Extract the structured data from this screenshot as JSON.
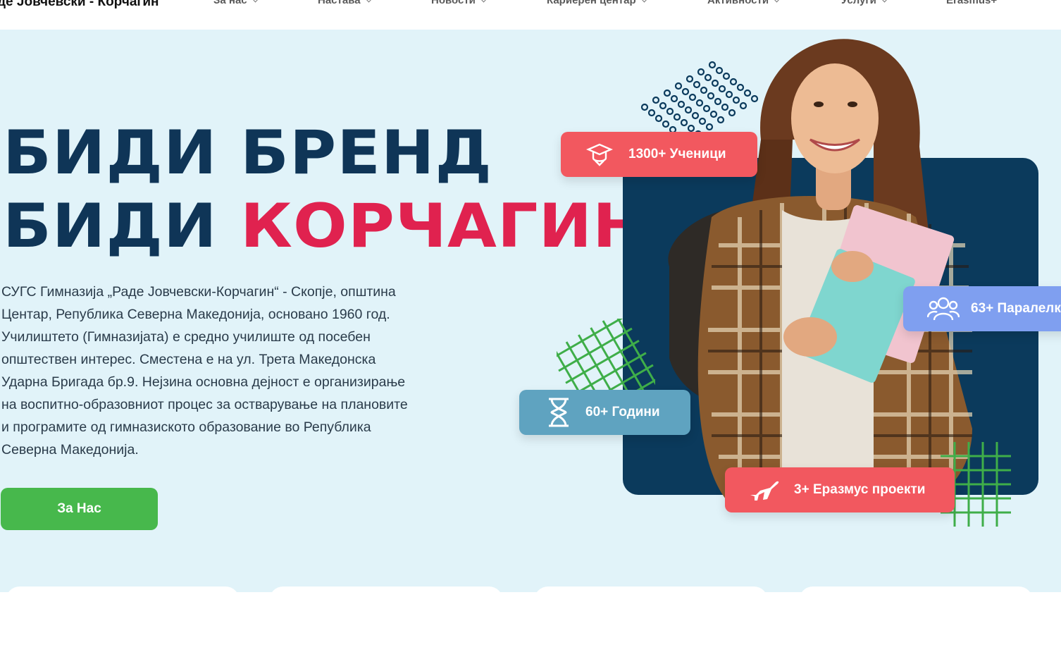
{
  "nav": {
    "brand": "де Јовчевски - Корчагин",
    "items": [
      {
        "label": "За нас"
      },
      {
        "label": "Настава"
      },
      {
        "label": "Новости"
      },
      {
        "label": "Кариерен центар"
      },
      {
        "label": "Активности"
      },
      {
        "label": "Услуги"
      },
      {
        "label": "Erasmus+"
      }
    ]
  },
  "hero": {
    "headline_line1": "БИДИ БРЕНД",
    "headline_line2_prefix": "БИДИ ",
    "headline_line2_accent": "КОРЧАГИН",
    "description": "СУГС Гимназија „Раде Јовчевски-Корчагин“ - Скопје, општина Центар, Република Северна Македонија, основано 1960 год. Училиштето (Гимназијата) е средно училиште од посебен општествен интерес. Сместена е на ул. Трета Македонска Ударна Бригада бр.9. Нејзина основна дејност е организирање на воспитно-образовниот процес за остварување на плановите и програмите од гимназиското образование во Република Северна Македонија.",
    "cta_label": "За Нас"
  },
  "stats": [
    {
      "label": "1300+ Ученици",
      "icon": "graduation-cap-icon",
      "color": "#f2585f"
    },
    {
      "label": "63+ Паралелк",
      "icon": "users-group-icon",
      "color": "#7f9ff0"
    },
    {
      "label": "60+ Години",
      "icon": "hourglass-icon",
      "color": "#5fa3c0"
    },
    {
      "label": "3+ Еразмус проекти",
      "icon": "airplane-icon",
      "color": "#f2585f"
    }
  ],
  "colors": {
    "navy": "#0f3557",
    "accent_red": "#e0224f",
    "green": "#47b84c",
    "hero_bg": "#e1f3f9"
  }
}
